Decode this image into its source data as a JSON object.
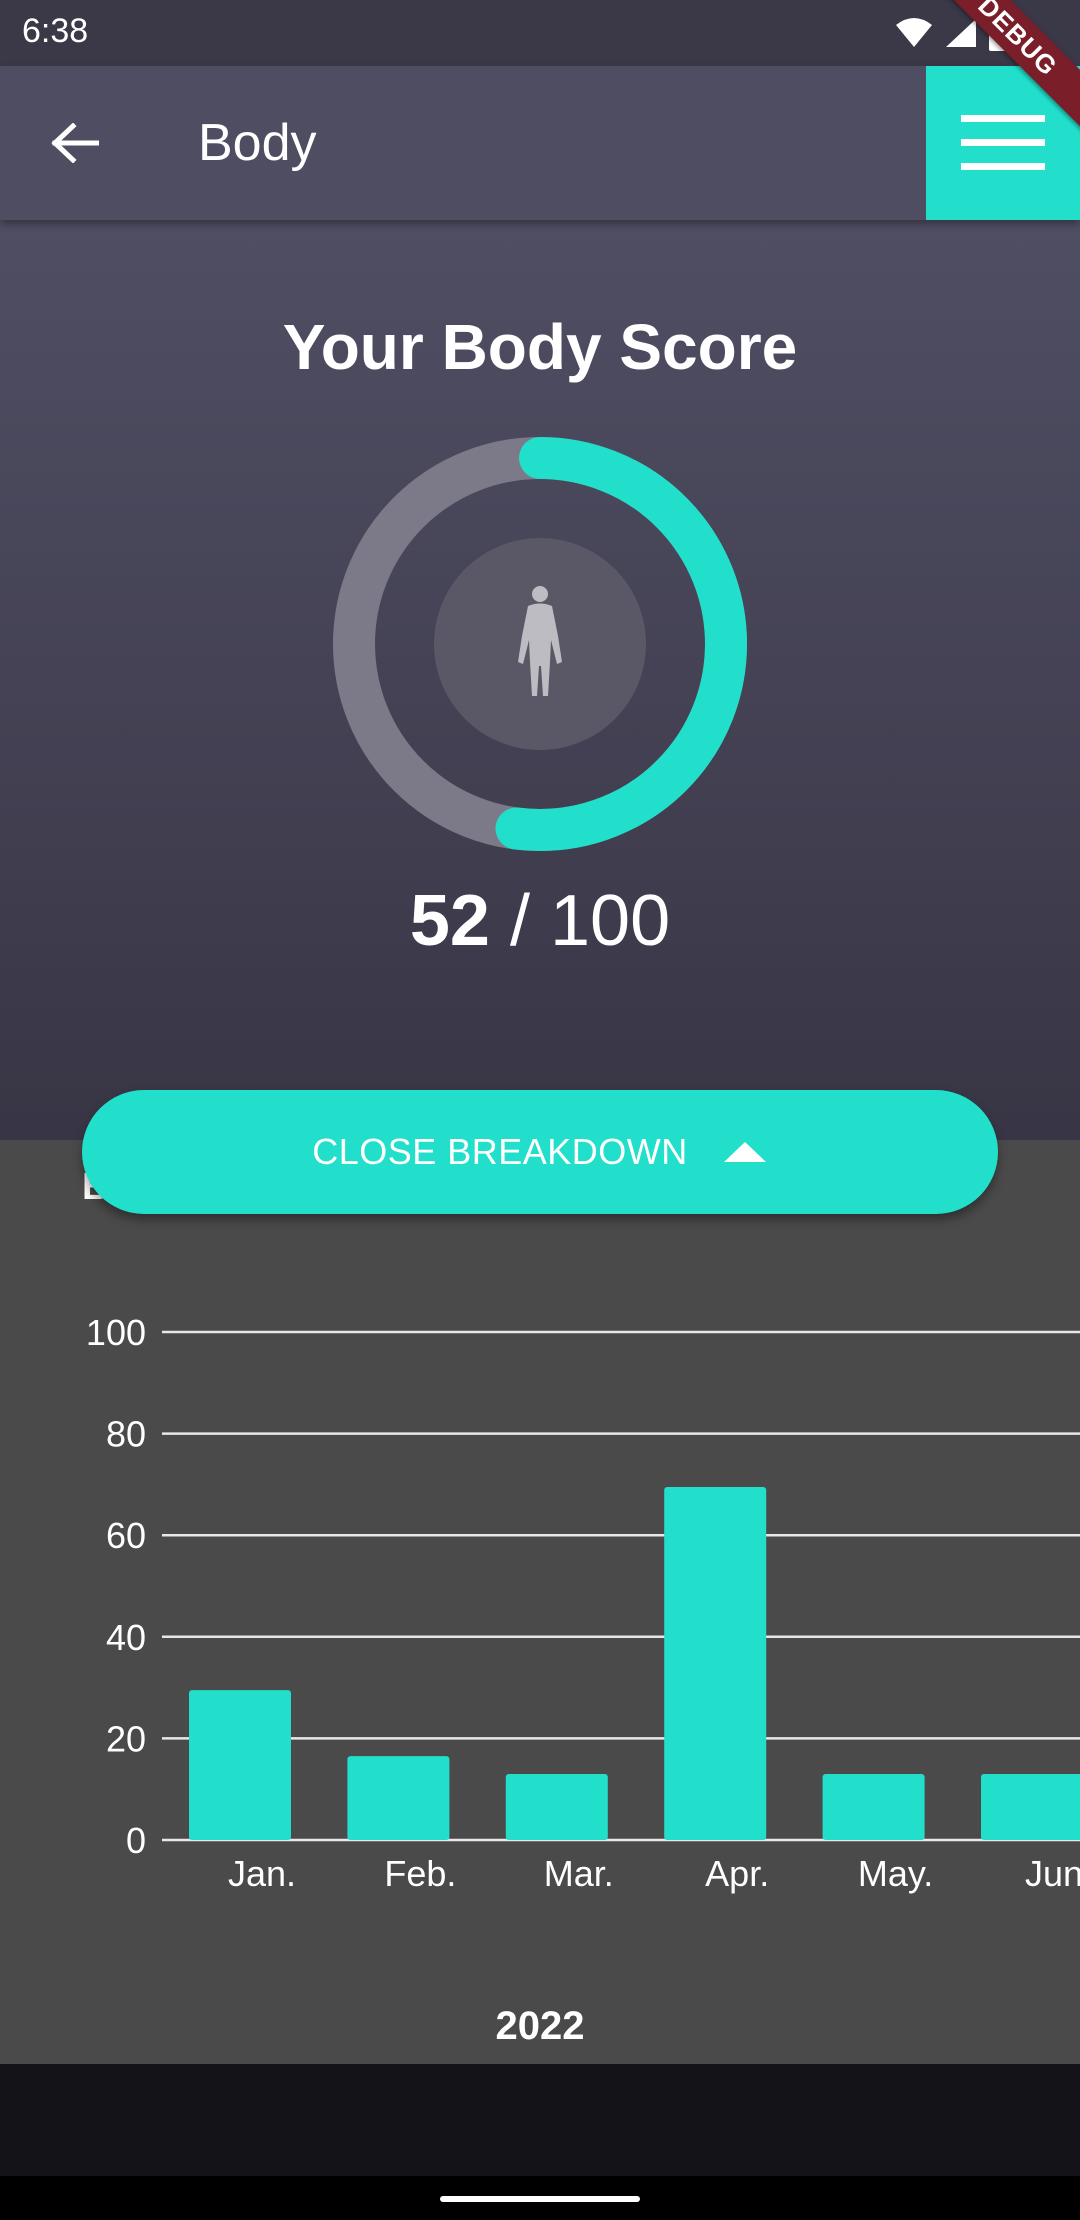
{
  "status_bar": {
    "time": "6:38"
  },
  "app_bar": {
    "title": "Body"
  },
  "debug_banner": "DEBUG",
  "score": {
    "title": "Your Body Score",
    "value": "52",
    "separator": "/",
    "max": "100"
  },
  "breakdown_button": {
    "label": "CLOSE BREAKDOWN"
  },
  "chart_panel": {
    "hidden_heading_letter": "B"
  },
  "colors": {
    "accent": "#22dfcc",
    "app_bar": "#4f4d61",
    "chart_background": "#4a4a4a",
    "ring_track": "#7c7a88"
  },
  "chart_data": {
    "type": "bar",
    "categories": [
      "Jan.",
      "Feb.",
      "Mar.",
      "Apr.",
      "May.",
      "Jun"
    ],
    "values": [
      29.5,
      16.5,
      13,
      69.5,
      13,
      13
    ],
    "ylim": [
      0,
      100
    ],
    "yticks": [
      0,
      20,
      40,
      60,
      80,
      100
    ],
    "xlabel": "2022",
    "ylabel": "",
    "grid": true
  }
}
